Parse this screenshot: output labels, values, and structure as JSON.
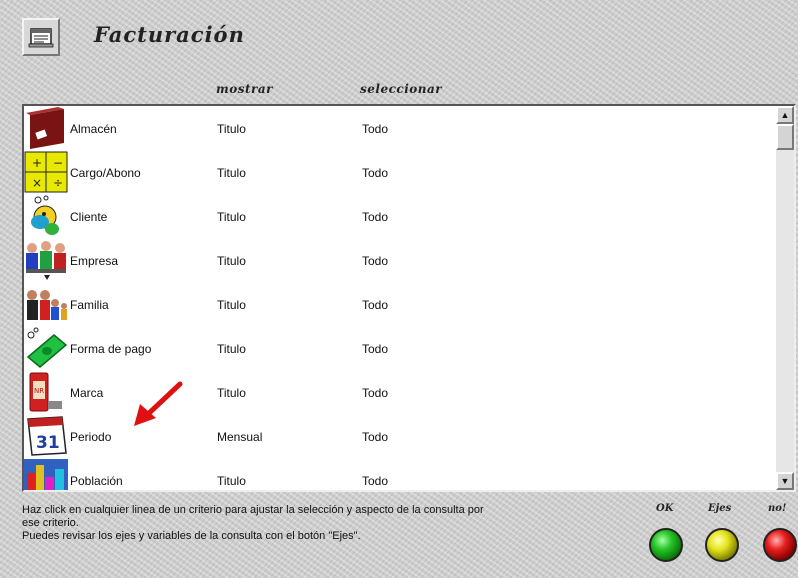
{
  "window": {
    "title": "Facturación",
    "icon": "report-icon"
  },
  "columns": {
    "show": "mostrar",
    "select": "seleccionar"
  },
  "rows": [
    {
      "name": "Almacén",
      "show": "Titulo",
      "select": "Todo",
      "icon": "warehouse-icon"
    },
    {
      "name": "Cargo/Abono",
      "show": "Titulo",
      "select": "Todo",
      "icon": "charge-credit-icon"
    },
    {
      "name": "Cliente",
      "show": "Titulo",
      "select": "Todo",
      "icon": "client-icon"
    },
    {
      "name": "Empresa",
      "show": "Titulo",
      "select": "Todo",
      "icon": "company-icon"
    },
    {
      "name": "Familia",
      "show": "Titulo",
      "select": "Todo",
      "icon": "family-icon"
    },
    {
      "name": "Forma de pago",
      "show": "Titulo",
      "select": "Todo",
      "icon": "payment-method-icon"
    },
    {
      "name": "Marca",
      "show": "Titulo",
      "select": "Todo",
      "icon": "brand-icon"
    },
    {
      "name": "Periodo",
      "show": "Mensual",
      "select": "Todo",
      "icon": "calendar-icon"
    },
    {
      "name": "Población",
      "show": "Titulo",
      "select": "Todo",
      "icon": "population-icon"
    }
  ],
  "help": {
    "line1": "Haz click en cualquier linea de un criterio para ajustar la selección y aspecto de la consulta por",
    "line2": "ese criterio.",
    "line3": "Puedes revisar los ejes y variables de la consulta con el botón \"Ejes\"."
  },
  "buttons": {
    "ok": "OK",
    "axes": "Ejes",
    "no": "no!"
  },
  "colors": {
    "ok": "#1fb81f",
    "axes": "#d8d81c",
    "no": "#e01818",
    "annotation_arrow": "#e01010"
  }
}
